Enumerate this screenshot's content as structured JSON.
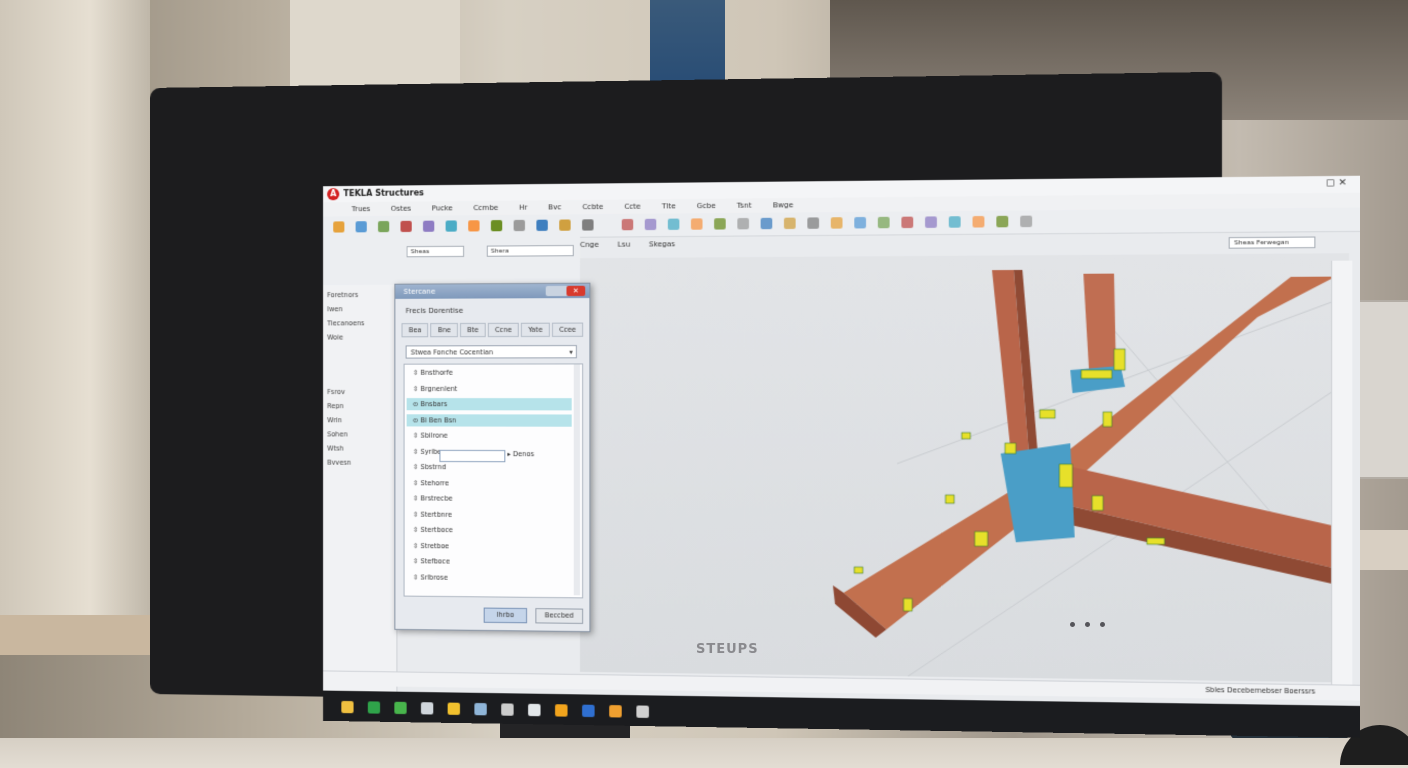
{
  "app": {
    "title": "TEKLA Structures",
    "logo_letter": "A",
    "brand_label": "STEUPS",
    "colors": {
      "accent": "#d42020",
      "steel": "#c2704e",
      "plate": "#4a9ec7",
      "bolt": "#e7e02a",
      "selection": "#b6e3ea"
    }
  },
  "menu": [
    "Trues",
    "Ostes",
    "Pucke",
    "Ccmbe",
    "Hr",
    "Bvc",
    "Ccbte",
    "Ccte",
    "Tlte",
    "Gcbe",
    "Tsnt",
    "Bwge"
  ],
  "toolbar": {
    "combo_1": "Sheas",
    "combo_2": "Shera",
    "view_tabs": [
      "Cnge",
      "Lsu",
      "Skegas"
    ],
    "right_search": "Sheas Ferwegan",
    "icons": [
      "folder-icon",
      "save-icon",
      "undo-icon",
      "redo-icon",
      "pencil-icon",
      "grid-icon",
      "select-icon",
      "magnet-icon",
      "snap-icon",
      "zoom-icon",
      "filter-icon",
      "settings-icon"
    ]
  },
  "left_panel": {
    "items": [
      "Foretnors",
      "Iwen",
      "Tiecanoens",
      "Woie",
      "Fsrov",
      "Repn",
      "Wrin",
      "Sohen",
      "Wtsh",
      "Bvvesn"
    ]
  },
  "dialog": {
    "title": "Stercane",
    "subtitle": "Frecis  Dorentise",
    "tabs": [
      "Bea",
      "Bne",
      "Bte",
      "Ccne",
      "Yate",
      "Ccee"
    ],
    "combo_value": "Stwea Fonche Cocentian",
    "list": [
      {
        "label": "Bnsthorfe",
        "selected": false
      },
      {
        "label": "Brgnenlent",
        "selected": false
      },
      {
        "label": "Bnsbars",
        "selected": true
      },
      {
        "label": "Bi Ben Bsn",
        "selected": true
      },
      {
        "label": "Sbilrone",
        "selected": false
      },
      {
        "label": "Syriben",
        "selected": false
      },
      {
        "label": "Sbstrnd",
        "selected": false
      },
      {
        "label": "Stehorre",
        "selected": false
      },
      {
        "label": "Brstrecbe",
        "selected": false
      },
      {
        "label": "Stertbnre",
        "selected": false
      },
      {
        "label": "Stertboce",
        "selected": false
      },
      {
        "label": "Stretboe",
        "selected": false
      },
      {
        "label": "Stefboce",
        "selected": false
      },
      {
        "label": "Srlbrose",
        "selected": false
      }
    ],
    "input_suffix": "Denos",
    "ok_label": "Ihrbo",
    "cancel_label": "Beccbed"
  },
  "status_bar": {
    "text": "Sbles  Decebernebser  Boerssrs"
  },
  "taskbar_icons": [
    "start-icon",
    "app-icon",
    "chart-icon",
    "monitor-icon",
    "note-icon",
    "files-icon",
    "network-icon",
    "globe-icon",
    "folder-icon",
    "calendar-icon",
    "image-icon",
    "settings-icon"
  ]
}
